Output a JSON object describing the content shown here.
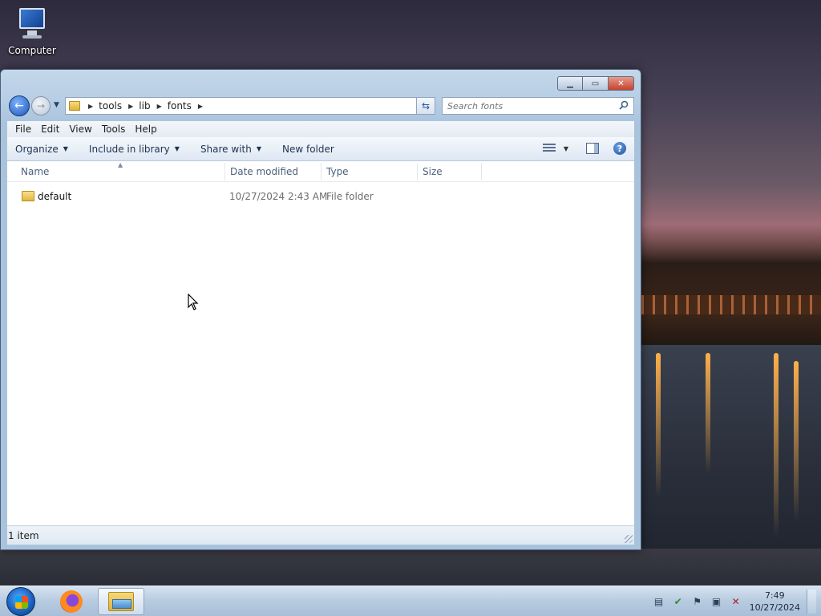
{
  "desktop": {
    "icons": [
      {
        "label": "Computer"
      }
    ]
  },
  "window": {
    "address": {
      "crumbs": [
        "tools",
        "lib",
        "fonts"
      ]
    },
    "search": {
      "placeholder": "Search fonts"
    },
    "menu": [
      {
        "label": "File"
      },
      {
        "label": "Edit"
      },
      {
        "label": "View"
      },
      {
        "label": "Tools"
      },
      {
        "label": "Help"
      }
    ],
    "commands": {
      "organize": "Organize",
      "include": "Include in library",
      "share": "Share with",
      "new_folder": "New folder"
    },
    "columns": {
      "name": "Name",
      "date": "Date modified",
      "type": "Type",
      "size": "Size"
    },
    "files": [
      {
        "name": "default",
        "date": "10/27/2024 2:43 AM",
        "type": "File folder",
        "size": ""
      }
    ],
    "status": "1 item"
  },
  "taskbar": {
    "apps": [
      "firefox-icon",
      "windows-explorer-icon"
    ],
    "clock": {
      "time": "7:49",
      "date": "10/27/2024"
    }
  }
}
